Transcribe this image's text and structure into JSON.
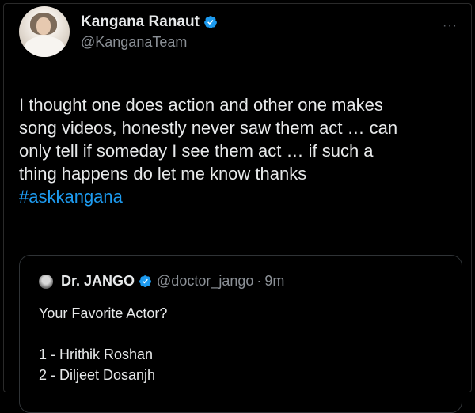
{
  "tweet": {
    "author": {
      "display_name": "Kangana Ranaut",
      "handle": "@KanganaTeam",
      "verified_icon": "verified-badge-icon"
    },
    "more_label": "···",
    "text_lines": [
      "I thought one does action and other one makes",
      "song videos, honestly never saw them act … can",
      "only tell if someday I see them act … if such a",
      "thing happens do let me know thanks"
    ],
    "hashtag": "#askkangana"
  },
  "quoted_tweet": {
    "author": {
      "display_name": "Dr. JANGO",
      "handle": "@doctor_jango",
      "separator": "·",
      "time": "9m"
    },
    "question": "Your Favorite Actor?",
    "options": [
      "1 - Hrithik Roshan",
      "2 - Diljeet Dosanjh"
    ]
  },
  "colors": {
    "background": "#000000",
    "text": "#e7e9ea",
    "secondary": "#8b9096",
    "link": "#1d9bf0",
    "verified": "#1d9bf0"
  }
}
